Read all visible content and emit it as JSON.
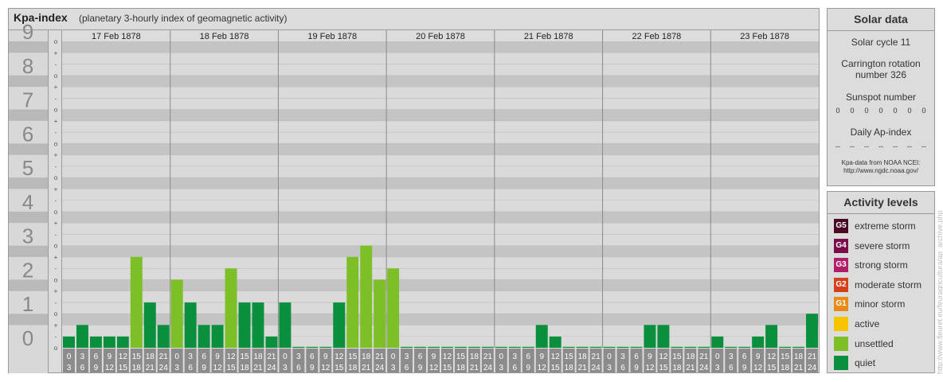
{
  "chart": {
    "title": "Kpa-index",
    "subtitle": "(planetary 3-hourly index of geomagnetic activity)"
  },
  "chart_data": {
    "type": "bar",
    "ylim": [
      0,
      9
    ],
    "y_major_ticks": [
      "0",
      "1",
      "2",
      "3",
      "4",
      "5",
      "6",
      "7",
      "8",
      "9"
    ],
    "y_minor_ticks": [
      "o",
      "-",
      "+"
    ],
    "days": [
      "17 Feb 1878",
      "18 Feb 1878",
      "19 Feb 1878",
      "20 Feb 1878",
      "21 Feb 1878",
      "22 Feb 1878",
      "23 Feb 1878"
    ],
    "interval_starts": [
      "0",
      "3",
      "6",
      "9",
      "12",
      "15",
      "18",
      "21"
    ],
    "interval_ends": [
      "3",
      "6",
      "9",
      "12",
      "15",
      "18",
      "21",
      "24"
    ],
    "values": [
      [
        0.33,
        0.67,
        0.33,
        0.33,
        0.33,
        2.67,
        1.33,
        0.67
      ],
      [
        2.0,
        1.33,
        0.67,
        0.67,
        2.33,
        1.33,
        1.33,
        0.33
      ],
      [
        1.33,
        0,
        0,
        0,
        1.33,
        2.67,
        3.0,
        2.0
      ],
      [
        2.33,
        0,
        0,
        0,
        0,
        0,
        0,
        0
      ],
      [
        0,
        0,
        0,
        0.67,
        0.33,
        0,
        0,
        0
      ],
      [
        0,
        0,
        0,
        0.67,
        0.67,
        0,
        0,
        0
      ],
      [
        0.33,
        0,
        0,
        0.33,
        0.67,
        0,
        0,
        1.0
      ]
    ],
    "colors": {
      "quiet": "#0a8f3c",
      "unsettled": "#7dbf26"
    }
  },
  "solar": {
    "title": "Solar data",
    "cycle": "Solar cycle 11",
    "carrington_line1": "Carrington rotation",
    "carrington_line2": "number 326",
    "sunspot_title": "Sunspot number",
    "sunspot_values": [
      "0",
      "0",
      "0",
      "0",
      "0",
      "0",
      "0"
    ],
    "ap_title": "Daily Ap-index",
    "ap_values": [
      "--",
      "--",
      "--",
      "--",
      "--",
      "--",
      "--"
    ],
    "source_line1": "Kpa-data from NOAA NCEI:",
    "source_line2": "http://www.ngdc.noaa.gov/"
  },
  "levels": {
    "title": "Activity levels",
    "items": [
      {
        "code": "G5",
        "label": "extreme storm",
        "color": "#4a0a26"
      },
      {
        "code": "G4",
        "label": "severe storm",
        "color": "#7a0d4a"
      },
      {
        "code": "G3",
        "label": "strong storm",
        "color": "#b01e6a"
      },
      {
        "code": "G2",
        "label": "moderate storm",
        "color": "#d4401a"
      },
      {
        "code": "G1",
        "label": "minor storm",
        "color": "#e88a18"
      },
      {
        "code": "",
        "label": "active",
        "color": "#f7c400"
      },
      {
        "code": "",
        "label": "unsettled",
        "color": "#7dbf26"
      },
      {
        "code": "",
        "label": "quiet",
        "color": "#0a8f3c"
      }
    ]
  },
  "watermark": "http://www.fleuret.eu/feuragricultura/ap_archive.php"
}
